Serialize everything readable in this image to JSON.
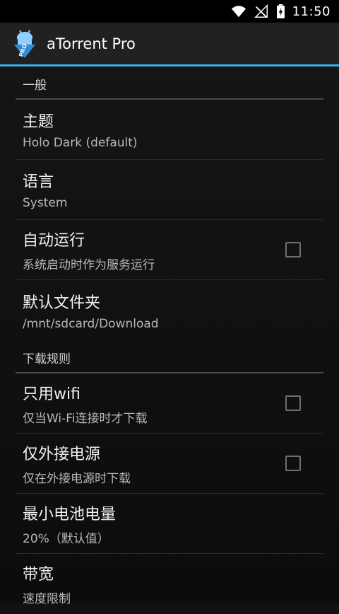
{
  "status_bar": {
    "time": "11:50"
  },
  "app": {
    "title": "aTorrent Pro",
    "logo_text": "PRO"
  },
  "sections": {
    "general": {
      "header": "一般",
      "theme": {
        "title": "主题",
        "summary": "Holo Dark (default)"
      },
      "language": {
        "title": "语言",
        "summary": "System"
      },
      "autostart": {
        "title": "自动运行",
        "summary": "系统启动时作为服务运行",
        "checked": false
      },
      "default_folder": {
        "title": "默认文件夹",
        "summary": "/mnt/sdcard/Download"
      }
    },
    "download_rules": {
      "header": "下载规则",
      "wifi_only": {
        "title": "只用wifi",
        "summary": "仅当Wi-Fi连接时才下载",
        "checked": false
      },
      "external_power": {
        "title": "仅外接电源",
        "summary": "仅在外接电源时下载",
        "checked": false
      },
      "min_battery": {
        "title": "最小电池电量",
        "summary": "20%（默认值）"
      },
      "bandwidth": {
        "title": "带宽",
        "summary": "速度限制"
      }
    }
  },
  "colors": {
    "accent": "#33b5e5",
    "actionbar": "#212121",
    "statusbar": "#000000"
  }
}
